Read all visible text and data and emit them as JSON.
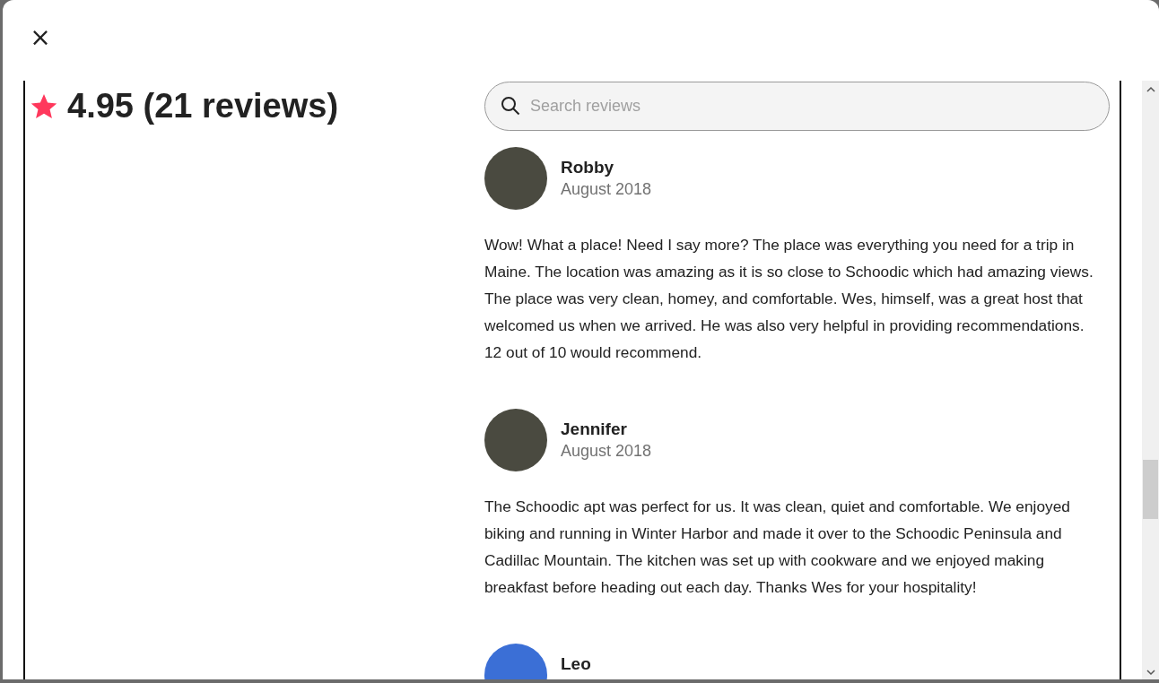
{
  "dialog": {
    "close_label": "×"
  },
  "rating": {
    "text": "4.95 (21 reviews)"
  },
  "search": {
    "placeholder": "Search reviews"
  },
  "reviews": [
    {
      "name": "Robby",
      "date": "August 2018",
      "text": "Wow! What a place! Need I say more? The place was everything you need for a trip in Maine. The location was amazing as it is so close to Schoodic which had amazing views. The place was very clean, homey, and comfortable. Wes, himself, was a great host that welcomed us when we arrived. He was also very helpful in providing recommendations. 12 out of 10 would recommend."
    },
    {
      "name": "Jennifer",
      "date": "August 2018",
      "text": "The Schoodic apt was perfect for us. It was clean, quiet and comfortable. We enjoyed biking and running in Winter Harbor and made it over to the Schoodic Peninsula and Cadillac Mountain. The kitchen was set up with cookware and we enjoyed making breakfast before heading out each day. Thanks Wes for your hospitality!"
    },
    {
      "name": "Leo"
    }
  ]
}
